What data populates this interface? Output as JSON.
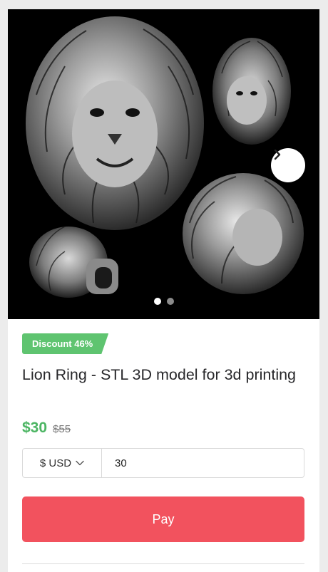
{
  "product": {
    "image_alt": "Lion ring sculpture renders on black background",
    "discount_badge": "Discount 46%",
    "title": "Lion Ring - STL 3D model for 3d printing",
    "price": "$30",
    "old_price": "$55"
  },
  "carousel": {
    "next_icon": "chevron-right-icon",
    "active_index": 0,
    "slide_count": 2
  },
  "purchase": {
    "currency_label": "$ USD",
    "amount_value": "30",
    "pay_label": "Pay"
  },
  "colors": {
    "discount": "#5fc470",
    "price": "#4cb563",
    "pay_button": "#f2525e"
  }
}
